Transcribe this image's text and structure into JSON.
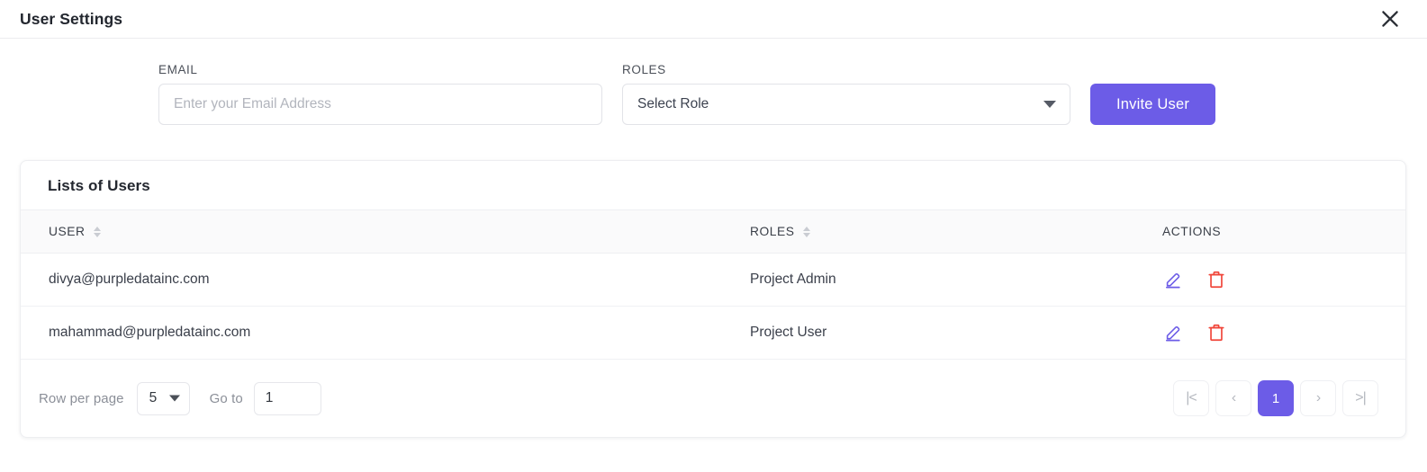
{
  "dialog": {
    "title": "User Settings",
    "close_icon": "close-icon"
  },
  "form": {
    "email": {
      "label": "EMAIL",
      "placeholder": "Enter your Email Address",
      "value": ""
    },
    "roles": {
      "label": "ROLES",
      "selected": "Select Role",
      "caret_icon": "chevron-down-icon"
    },
    "invite_button": "Invite User"
  },
  "users_card": {
    "title": "Lists of Users",
    "columns": [
      {
        "label": "USER",
        "sortable": true
      },
      {
        "label": "ROLES",
        "sortable": true
      },
      {
        "label": "ACTIONS",
        "sortable": false
      }
    ],
    "rows": [
      {
        "user": "divya@purpledatainc.com",
        "role": "Project Admin",
        "edit_icon": "pencil-edit-icon",
        "delete_icon": "trash-delete-icon"
      },
      {
        "user": "mahammad@purpledatainc.com",
        "role": "Project User",
        "edit_icon": "pencil-edit-icon",
        "delete_icon": "trash-delete-icon"
      }
    ]
  },
  "footer": {
    "rows_per_page_label": "Row per page",
    "rows_per_page_value": "5",
    "goto_label": "Go to",
    "goto_value": "1",
    "pagination": {
      "first": "|<",
      "prev": "‹",
      "current_page": "1",
      "next": "›",
      "last": ">|"
    }
  },
  "colors": {
    "accent": "#6c5ce7",
    "delete": "#f04438",
    "edit": "#6c5ce7",
    "text": "#3a3f4a",
    "muted": "#8b8f98"
  }
}
